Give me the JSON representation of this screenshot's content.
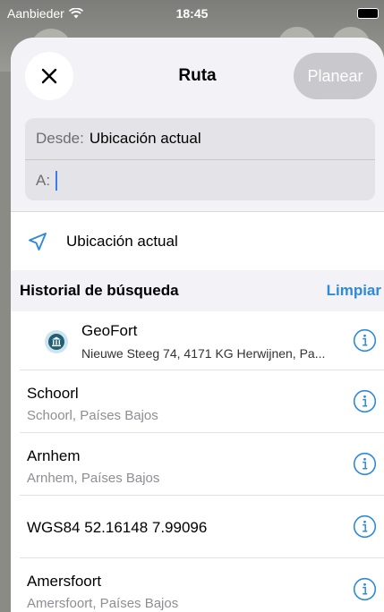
{
  "status_bar": {
    "carrier": "Aanbieder",
    "time": "18:45"
  },
  "header": {
    "title": "Ruta",
    "plan_label": "Planear"
  },
  "route": {
    "from_label": "Desde:",
    "from_value": "Ubicación actual",
    "to_label": "A:"
  },
  "current_location_label": "Ubicación actual",
  "history": {
    "title": "Historial de búsqueda",
    "clear_label": "Limpiar",
    "items": [
      {
        "title": "GeoFort",
        "subtitle": "Nieuwe Steeg 74, 4171 KG Herwijnen, Pa...",
        "icon": "museum-icon"
      },
      {
        "title": "Schoorl",
        "subtitle": "Schoorl, Países Bajos"
      },
      {
        "title": "Arnhem",
        "subtitle": "Arnhem, Países Bajos"
      },
      {
        "title": "WGS84 52.16148 7.99096"
      },
      {
        "title": "Amersfoort",
        "subtitle": "Amersfoort, Países Bajos"
      }
    ]
  },
  "colors": {
    "accent": "#2f8ad8",
    "caret": "#3c7bf6",
    "disabled_button": "#c8c8cd",
    "museum_icon": "#1f5f78"
  }
}
